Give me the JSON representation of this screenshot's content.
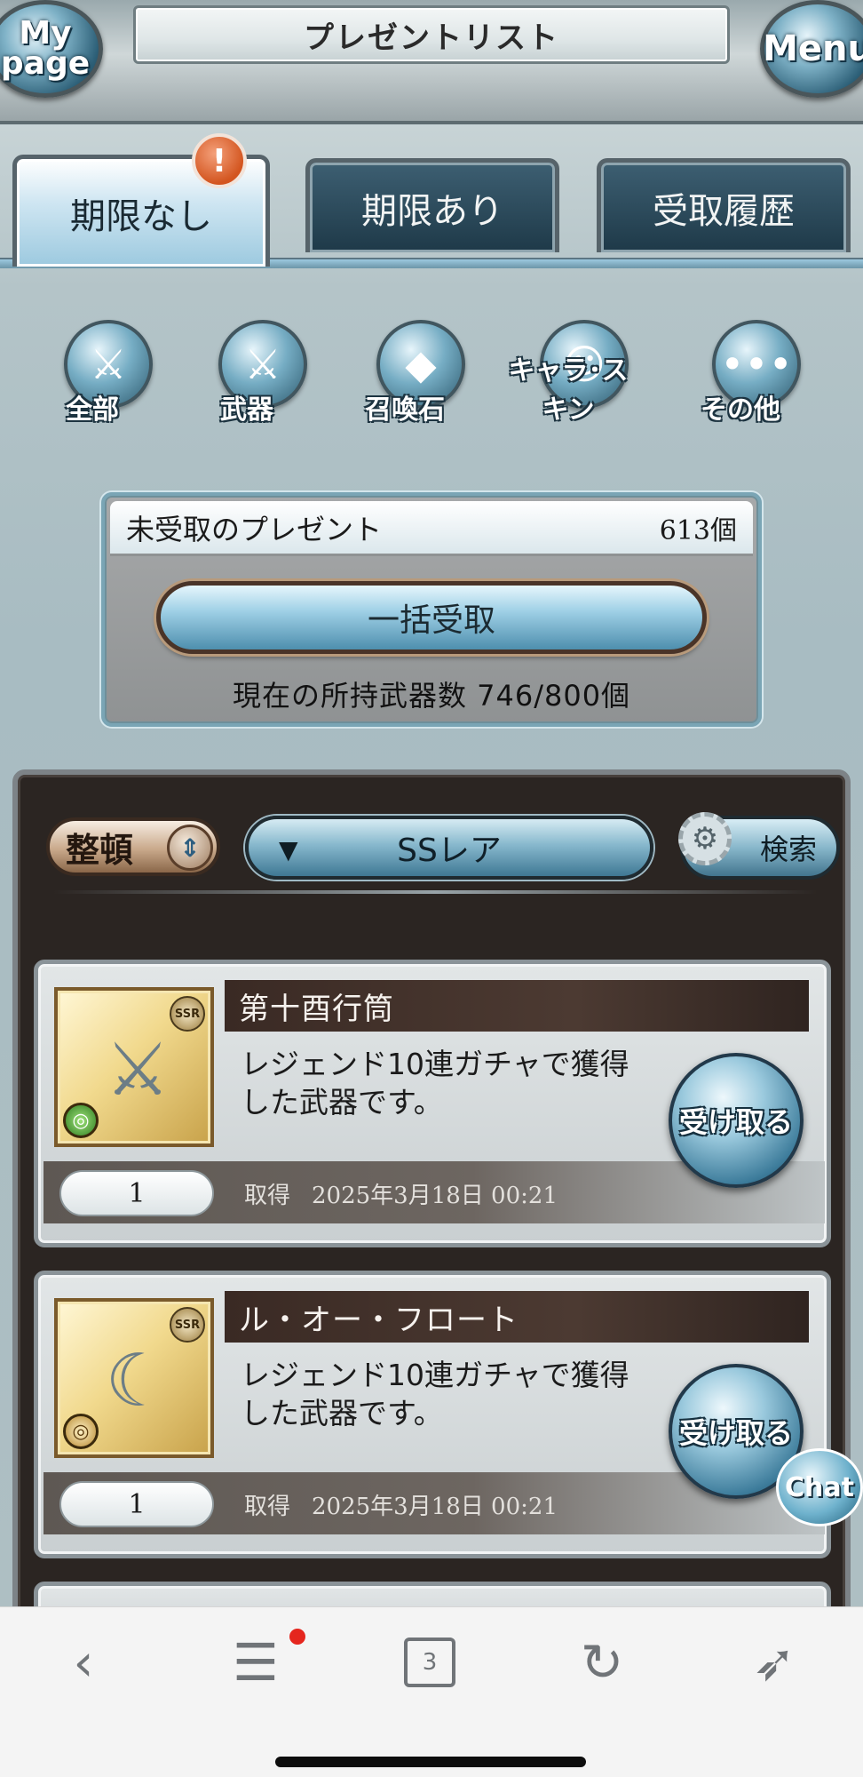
{
  "header": {
    "title": "プレゼントリスト",
    "mypage_label": "My page",
    "menu_label": "Menu"
  },
  "tabs": [
    {
      "label": "期限なし",
      "active": true
    },
    {
      "label": "期限あり",
      "active": false
    },
    {
      "label": "受取履歴",
      "active": false
    }
  ],
  "alert_badge": "!",
  "categories": [
    {
      "label": "全部",
      "icon": "all-icon",
      "glyph": "⚔"
    },
    {
      "label": "武器",
      "icon": "weapon-icon",
      "glyph": "⚔"
    },
    {
      "label": "召喚石",
      "icon": "summon-stone-icon",
      "glyph": "◆"
    },
    {
      "label": "キャラ･スキン",
      "icon": "character-icon",
      "glyph": "☺"
    },
    {
      "label": "その他",
      "icon": "other-icon",
      "glyph": "•••"
    }
  ],
  "summary": {
    "unreceived_label": "未受取のプレゼント",
    "unreceived_count": "613個",
    "bulk_receive_label": "一括受取",
    "owned_weapons_text": "現在の所持武器数  746/800個"
  },
  "toolbar": {
    "sort_label": "整頓",
    "filter_value": "SSレア",
    "filter_arrow": "▼",
    "search_label": "検索"
  },
  "items": [
    {
      "name": "第十酉行筒",
      "description": "レジェンド10連ガチャで獲得した武器です。",
      "receive_label": "受け取る",
      "quantity": "1",
      "acquired_label": "取得",
      "acquired_date": "2025年3月18日 00:21",
      "rarity": "SSR",
      "element": "wind"
    },
    {
      "name": "ル・オー・フロート",
      "description": "レジェンド10連ガチャで獲得した武器です。",
      "receive_label": "受け取る",
      "quantity": "1",
      "acquired_label": "取得",
      "acquired_date": "2025年3月18日 00:21",
      "rarity": "SSR",
      "element": "light"
    }
  ],
  "chat_label": "Chat",
  "browser_bar": {
    "tab_count": "3"
  },
  "colors": {
    "accent_blue": "#7fb2c7",
    "alert_orange": "#d3551f",
    "panel_dark": "#2b2522"
  }
}
